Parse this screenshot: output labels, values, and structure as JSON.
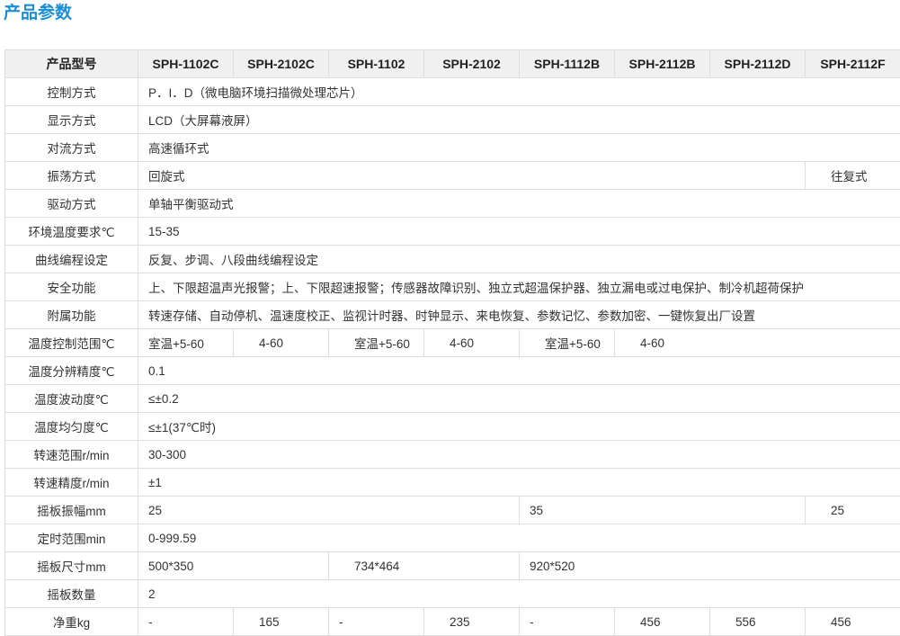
{
  "title": "产品参数",
  "header": {
    "label": "产品型号",
    "models": [
      "SPH-1102C",
      "SPH-2102C",
      "SPH-1102",
      "SPH-2102",
      "SPH-1112B",
      "SPH-2112B",
      "SPH-2112D",
      "SPH-2112F"
    ]
  },
  "rows": {
    "control": {
      "label": "控制方式",
      "value": "P．I．D（微电脑环境扫描微处理芯片）"
    },
    "display": {
      "label": "显示方式",
      "value": "LCD（大屏幕液屏）"
    },
    "convection": {
      "label": "对流方式",
      "value": "高速循环式"
    },
    "oscillation": {
      "label": "振荡方式",
      "value": "回旋式",
      "value_f": "往复式"
    },
    "drive": {
      "label": "驱动方式",
      "value": "单轴平衡驱动式"
    },
    "ambient": {
      "label": "环境温度要求℃",
      "value": "15-35"
    },
    "curve": {
      "label": "曲线编程设定",
      "value": "反复、步调、八段曲线编程设定"
    },
    "safety": {
      "label": "安全功能",
      "value": "上、下限超温声光报警；上、下限超速报警；传感器故障识别、独立式超温保护器、独立漏电或过电保护、制冷机超荷保护"
    },
    "accessory": {
      "label": "附属功能",
      "value": "转速存储、自动停机、温速度校正、监视计时器、时钟显示、来电恢复、参数记忆、参数加密、一键恢复出厂设置"
    },
    "temp_range": {
      "label": "温度控制范围℃",
      "values": [
        "室温+5-60",
        "4-60",
        "室温+5-60",
        "4-60",
        "室温+5-60",
        "4-60"
      ]
    },
    "temp_resolution": {
      "label": "温度分辨精度℃",
      "value": "0.1"
    },
    "temp_fluctuation": {
      "label": "温度波动度℃",
      "value": "≤±0.2"
    },
    "temp_uniformity": {
      "label": "温度均匀度℃",
      "value": "≤±1(37℃时)"
    },
    "speed_range": {
      "label": "转速范围r/min",
      "value": "30-300"
    },
    "speed_accuracy": {
      "label": "转速精度r/min",
      "value": "±1"
    },
    "amplitude": {
      "label": "摇板振幅mm",
      "values": [
        "25",
        "35",
        "25"
      ]
    },
    "timer": {
      "label": "定时范围min",
      "value": "0-999.59"
    },
    "platform_size": {
      "label": "摇板尺寸mm",
      "values": [
        "500*350",
        "734*464",
        "920*520"
      ]
    },
    "platform_count": {
      "label": "摇板数量",
      "value": "2"
    },
    "weight": {
      "label": "净重kg",
      "values": [
        "-",
        "165",
        "-",
        "235",
        "-",
        "456",
        "556",
        "456"
      ]
    }
  }
}
